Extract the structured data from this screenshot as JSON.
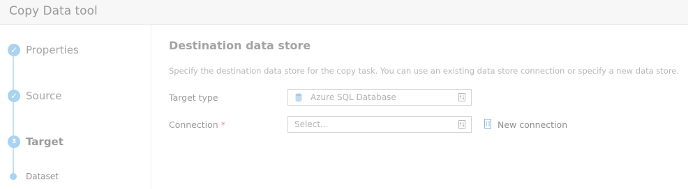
{
  "app": {
    "title": "Copy Data tool"
  },
  "steps": [
    {
      "icon": "check-icon",
      "label": "Properties",
      "state": "done"
    },
    {
      "icon": "check-icon",
      "label": "Source",
      "state": "done"
    },
    {
      "icon": "step-number-icon",
      "number": "3",
      "label": "Target",
      "state": "current"
    },
    {
      "icon": "sub-step-dot-icon",
      "label": "Dataset",
      "state": "sub"
    }
  ],
  "main": {
    "title": "Destination data store",
    "description": "Specify the destination data store for the copy task. You can use an existing data store connection or specify a new data store.",
    "target_type": {
      "label": "Target type",
      "value": "Azure SQL Database",
      "icon": "database-icon"
    },
    "connection": {
      "label": "Connection",
      "required_mark": "*",
      "placeholder": "Select..."
    },
    "new_connection": {
      "label": "New connection",
      "icon": "new-connection-icon"
    }
  },
  "colors": {
    "accent": "#a9d3f1",
    "rail": "#c4dff3",
    "required": "#e38b8b"
  }
}
